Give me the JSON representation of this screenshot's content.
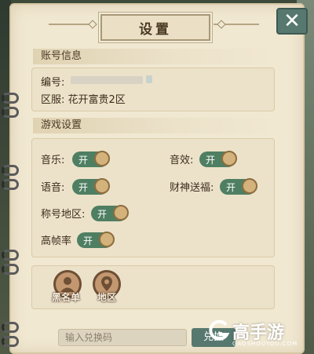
{
  "header": {
    "title": "设置",
    "close_icon": "close-icon"
  },
  "account": {
    "section_title": "账号信息",
    "id_label": "编号:",
    "server_label": "区服: 花开富贵2区"
  },
  "game_settings": {
    "section_title": "游戏设置",
    "options": [
      {
        "label": "音乐:",
        "state": "开"
      },
      {
        "label": "音效:",
        "state": "开"
      },
      {
        "label": "语音:",
        "state": "开"
      },
      {
        "label": "财神送福:",
        "state": "开"
      },
      {
        "label": "称号地区:",
        "state": "开"
      },
      {
        "label": "高帧率",
        "state": "开"
      }
    ]
  },
  "actions": {
    "blacklist": {
      "label": "黑名单",
      "icon": "person-icon"
    },
    "region": {
      "label": "地区",
      "icon": "location-pin-icon"
    }
  },
  "redeem": {
    "placeholder": "输入兑换码",
    "button_label": "兑换"
  },
  "watermark": {
    "brand": "高手游",
    "domain": "GAOSHOUYOU.COM"
  },
  "colors": {
    "toggle_on": "#4f7f62",
    "accent": "#57786e",
    "paper": "#f1e8d2"
  }
}
